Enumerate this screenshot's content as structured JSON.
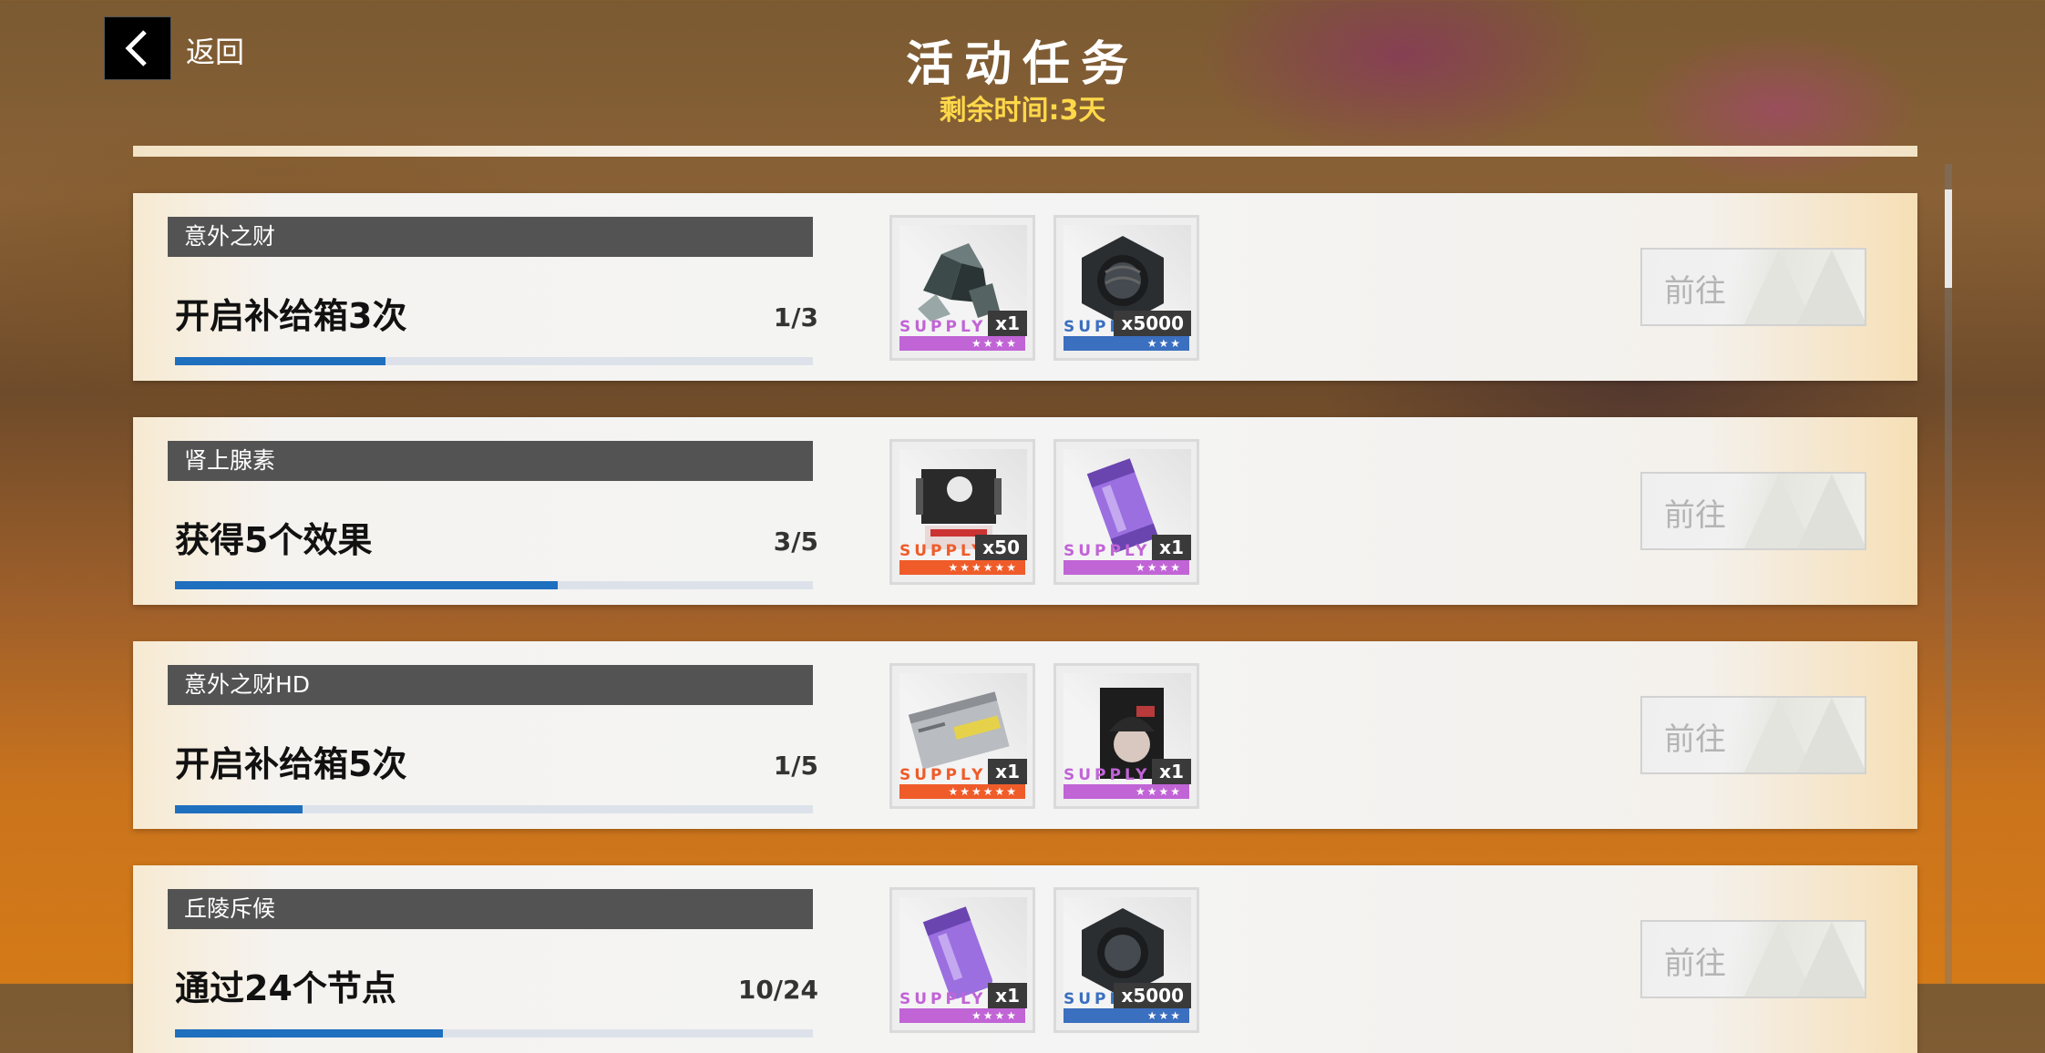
{
  "header": {
    "back_label": "返回",
    "title": "活动任务",
    "remaining_label": "剩余时间:",
    "remaining_value": "3天"
  },
  "tasks": [
    {
      "name": "意外之财",
      "description": "开启补给箱3次",
      "progress_text": "1/3",
      "progress": 0.33,
      "goto_label": "前往",
      "rewards": [
        {
          "icon": "crystal-ore-icon",
          "quantity": "x1",
          "supply": "SUPPLY",
          "stars": "★★★★",
          "rarity_color": "#c164d6"
        },
        {
          "icon": "hex-nut-icon",
          "quantity": "x5000",
          "supply": "SUPPLY",
          "stars": "★★★",
          "rarity_color": "#3b6fbf"
        }
      ]
    },
    {
      "name": "肾上腺素",
      "description": "获得5个效果",
      "progress_text": "3/5",
      "progress": 0.6,
      "goto_label": "前往",
      "rewards": [
        {
          "icon": "chip-module-icon",
          "quantity": "x50",
          "supply": "SUPPLY",
          "stars": "★★★★★★",
          "rarity_color": "#ef5c2a"
        },
        {
          "icon": "purple-canister-icon",
          "quantity": "x1",
          "supply": "SUPPLY",
          "stars": "★★★★",
          "rarity_color": "#c164d6"
        }
      ]
    },
    {
      "name": "意外之财HD",
      "description": "开启补给箱5次",
      "progress_text": "1/5",
      "progress": 0.2,
      "goto_label": "前往",
      "rewards": [
        {
          "icon": "metal-card-icon",
          "quantity": "x1",
          "supply": "SUPPLY",
          "stars": "★★★★★★",
          "rarity_color": "#ef5c2a"
        },
        {
          "icon": "character-card-icon",
          "quantity": "x1",
          "supply": "SUPPLY",
          "stars": "★★★★",
          "rarity_color": "#c164d6"
        }
      ]
    },
    {
      "name": "丘陵斥候",
      "description": "通过24个节点",
      "progress_text": "10/24",
      "progress": 0.42,
      "goto_label": "前往",
      "rewards": [
        {
          "icon": "purple-canister-icon",
          "quantity": "x1",
          "supply": "SUPPLY",
          "stars": "★★★★",
          "rarity_color": "#c164d6"
        },
        {
          "icon": "hex-nut-icon",
          "quantity": "x5000",
          "supply": "SUPPLY",
          "stars": "★★★",
          "rarity_color": "#3b6fbf"
        }
      ]
    }
  ]
}
